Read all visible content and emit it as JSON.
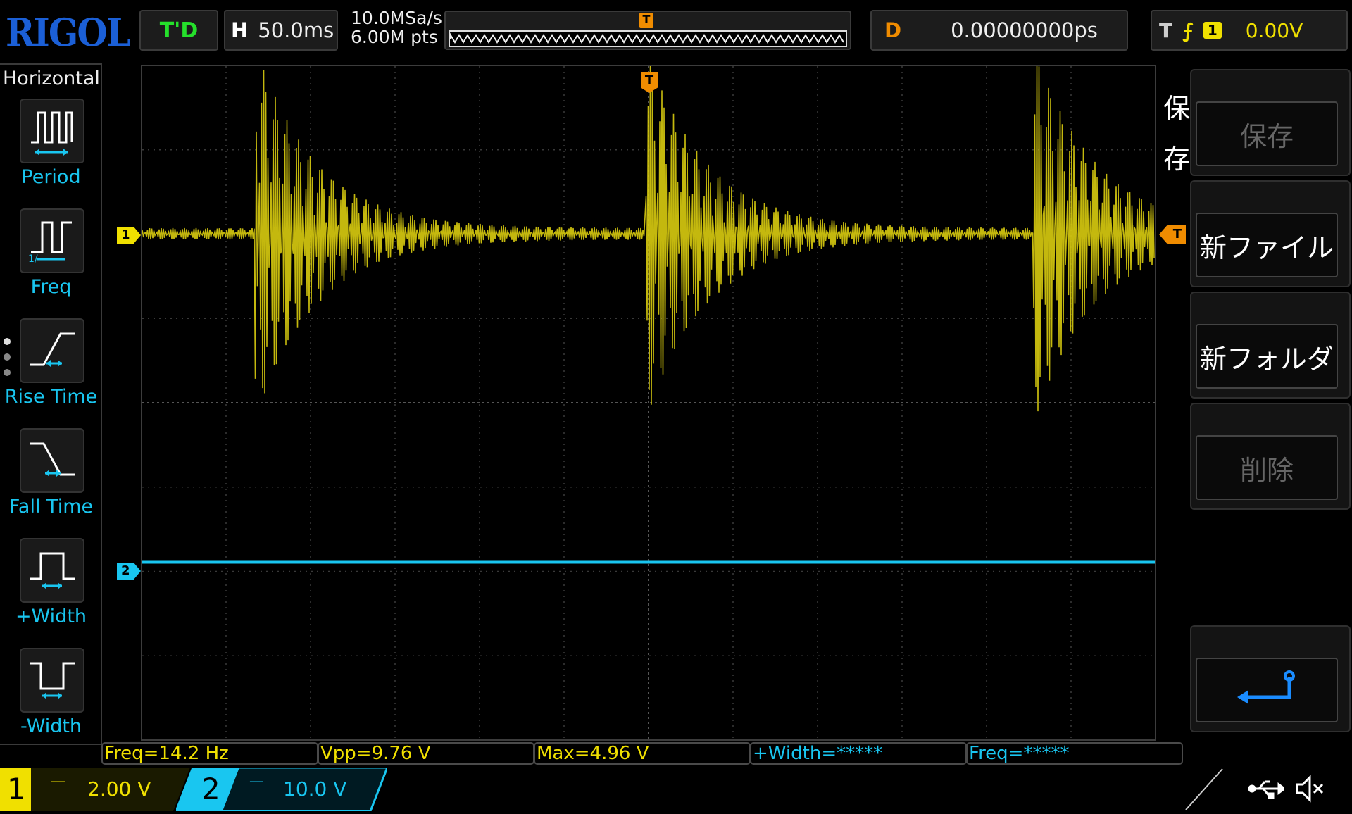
{
  "header": {
    "logo": "RIGOL",
    "run_state": "T'D",
    "timebase_key": "H",
    "timebase": "50.0ms",
    "sample_rate": "10.0MSa/s",
    "memory_depth": "6.00M pts",
    "trigger_marker": "T",
    "delay_key": "D",
    "delay": "0.00000000ps",
    "trigger_key": "T",
    "trigger_edge": "⨍",
    "trigger_source": "1",
    "trigger_level": "0.00V"
  },
  "left_menu": {
    "title": "Horizontal",
    "items": [
      {
        "label": "Period",
        "icon": "period-icon"
      },
      {
        "label": "Freq",
        "icon": "freq-icon"
      },
      {
        "label": "Rise Time",
        "icon": "rise-time-icon"
      },
      {
        "label": "Fall Time",
        "icon": "fall-time-icon"
      },
      {
        "label": "+Width",
        "icon": "positive-width-icon"
      },
      {
        "label": "-Width",
        "icon": "negative-width-icon"
      }
    ]
  },
  "channels": {
    "ch1": {
      "marker": "1",
      "number": "1",
      "coupling": "⎓",
      "scale": "2.00 V",
      "color": "#f0e000"
    },
    "ch2": {
      "marker": "2",
      "number": "2",
      "coupling": "⎓",
      "scale": "10.0 V",
      "color": "#19c6f0"
    }
  },
  "trigger_level_marker": "T",
  "right_menu": {
    "title": "保\n存",
    "buttons": [
      {
        "label": "保存",
        "enabled": false
      },
      {
        "label": "新ファイル",
        "enabled": true
      },
      {
        "label": "新フォルダ",
        "enabled": true
      },
      {
        "label": "削除",
        "enabled": false
      },
      {
        "label": "",
        "icon": "enter-arrow-icon",
        "enabled": true
      }
    ]
  },
  "measurements": [
    {
      "text": "Freq=14.2 Hz",
      "channel": "1"
    },
    {
      "text": "Vpp=9.76 V",
      "channel": "1"
    },
    {
      "text": "Max=4.96 V",
      "channel": "1"
    },
    {
      "text": "+Width=*****",
      "channel": "2"
    },
    {
      "text": "Freq=*****",
      "channel": "2"
    }
  ],
  "status": {
    "usb_icon": "usb-icon",
    "sound_icon": "speaker-muted-icon"
  }
}
